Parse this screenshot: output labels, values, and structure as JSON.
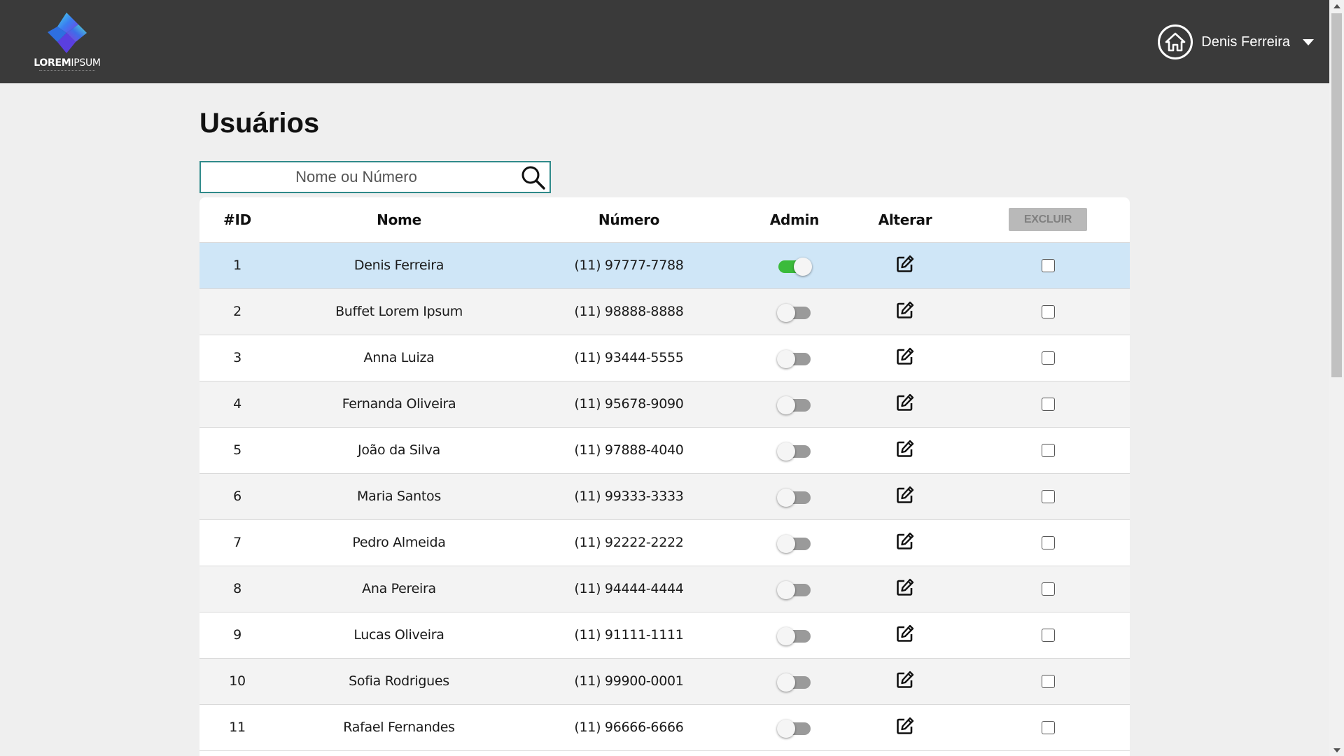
{
  "header": {
    "logo_bold": "LOREM",
    "logo_light": "IPSUM",
    "user_name": "Denis Ferreira",
    "icons": [
      "logo-mark",
      "home-icon",
      "caret-down-icon"
    ]
  },
  "page": {
    "title": "Usuários",
    "search_placeholder": "Nome ou Número"
  },
  "table": {
    "headers": {
      "id": "#ID",
      "name": "Nome",
      "number": "Número",
      "admin": "Admin",
      "edit": "Alterar",
      "delete": "EXCLUIR"
    },
    "rows": [
      {
        "id": "1",
        "name": "Denis Ferreira",
        "number": "(11) 97777-7788",
        "admin": true,
        "selected": true
      },
      {
        "id": "2",
        "name": "Buffet Lorem Ipsum",
        "number": "(11) 98888-8888",
        "admin": false
      },
      {
        "id": "3",
        "name": "Anna Luiza",
        "number": "(11) 93444-5555",
        "admin": false
      },
      {
        "id": "4",
        "name": "Fernanda Oliveira",
        "number": "(11) 95678-9090",
        "admin": false
      },
      {
        "id": "5",
        "name": "João da Silva",
        "number": "(11) 97888-4040",
        "admin": false
      },
      {
        "id": "6",
        "name": "Maria Santos",
        "number": "(11) 99333-3333",
        "admin": false
      },
      {
        "id": "7",
        "name": "Pedro Almeida",
        "number": "(11) 92222-2222",
        "admin": false
      },
      {
        "id": "8",
        "name": "Ana Pereira",
        "number": "(11) 94444-4444",
        "admin": false
      },
      {
        "id": "9",
        "name": "Lucas Oliveira",
        "number": "(11) 91111-1111",
        "admin": false
      },
      {
        "id": "10",
        "name": "Sofia Rodrigues",
        "number": "(11) 99900-0001",
        "admin": false
      },
      {
        "id": "11",
        "name": "Rafael Fernandes",
        "number": "(11) 96666-6666",
        "admin": false
      }
    ]
  },
  "colors": {
    "header_bg": "#3a3a3a",
    "page_bg": "#efefef",
    "selected_row": "#cfe6f7",
    "toggle_on": "#3bbb3b",
    "search_border": "#2f8a8a"
  }
}
